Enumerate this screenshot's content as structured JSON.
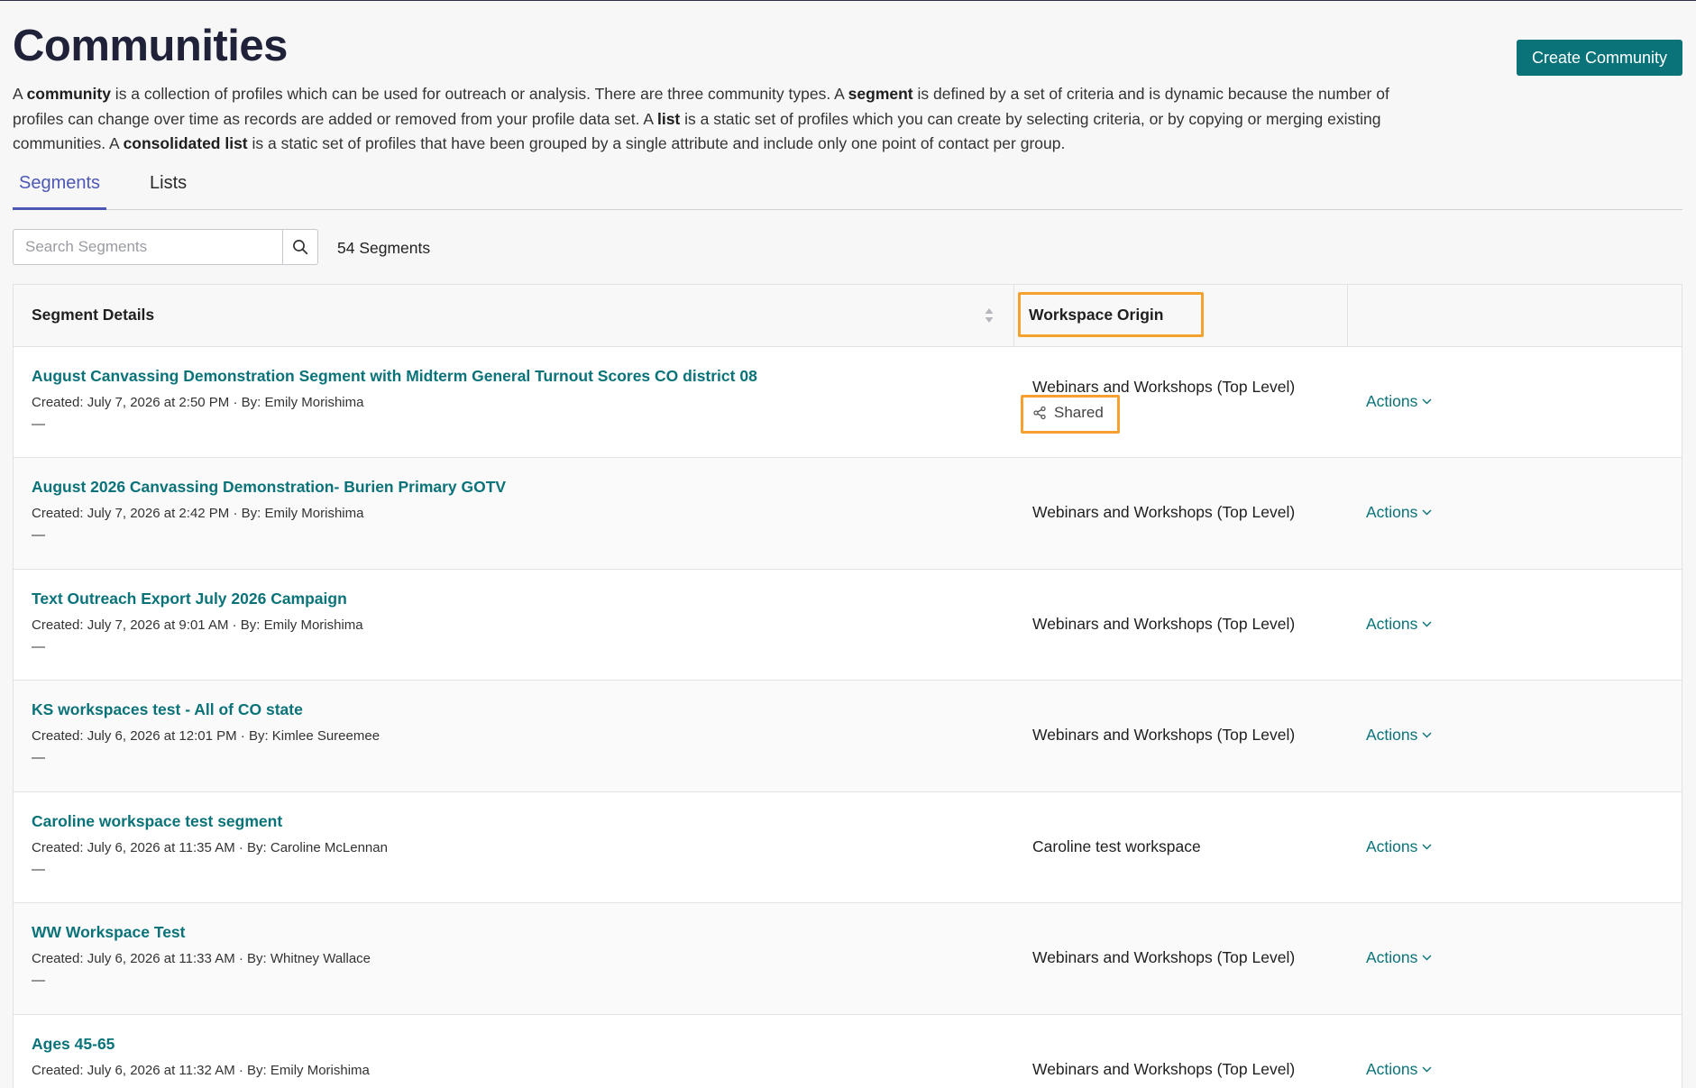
{
  "page": {
    "title": "Communities",
    "create_button": "Create Community",
    "description": {
      "p1": "A ",
      "b1": "community",
      "p2": " is a collection of profiles which can be used for outreach or analysis. There are three community types. A ",
      "b2": "segment",
      "p3": " is defined by a set of criteria and is dynamic because the number of profiles can change over time as records are added or removed from your profile data set. A ",
      "b3": "list",
      "p4": " is a static set of profiles which you can create by selecting criteria, or by copying or merging existing communities. A ",
      "b4": "consolidated list",
      "p5": " is a static set of profiles that have been grouped by a single attribute and include only one point of contact per group."
    }
  },
  "tabs": [
    {
      "label": "Segments",
      "active": true
    },
    {
      "label": "Lists",
      "active": false
    }
  ],
  "search": {
    "placeholder": "Search Segments",
    "value": "",
    "icon": "search-icon"
  },
  "segment_count": "54 Segments",
  "table": {
    "headers": {
      "details": "Segment Details",
      "origin": "Workspace Origin",
      "actions": ""
    },
    "rows": [
      {
        "name": "August Canvassing Demonstration Segment with Midterm General Turnout Scores CO district 08",
        "meta": "Created: July 7, 2026 at 2:50 PM · By: Emily Morishima",
        "dash": "—",
        "origin": "Webinars and Workshops (Top Level)",
        "shared": "Shared",
        "action": "Actions"
      },
      {
        "name": "August 2026 Canvassing Demonstration- Burien Primary GOTV",
        "meta": "Created: July 7, 2026 at 2:42 PM · By: Emily Morishima",
        "dash": "—",
        "origin": "Webinars and Workshops (Top Level)",
        "action": "Actions"
      },
      {
        "name": "Text Outreach Export July 2026 Campaign",
        "meta": "Created: July 7, 2026 at 9:01 AM · By: Emily Morishima",
        "dash": "—",
        "origin": "Webinars and Workshops (Top Level)",
        "action": "Actions"
      },
      {
        "name": "KS workspaces test - All of CO state",
        "meta": "Created: July 6, 2026 at 12:01 PM · By: Kimlee Sureemee",
        "dash": "—",
        "origin": "Webinars and Workshops (Top Level)",
        "action": "Actions"
      },
      {
        "name": "Caroline workspace test segment",
        "meta": "Created: July 6, 2026 at 11:35 AM · By: Caroline McLennan",
        "dash": "—",
        "origin": "Caroline test workspace",
        "action": "Actions"
      },
      {
        "name": "WW Workspace Test",
        "meta": "Created: July 6, 2026 at 11:33 AM · By: Whitney Wallace",
        "dash": "—",
        "origin": "Webinars and Workshops (Top Level)",
        "action": "Actions"
      },
      {
        "name": "Ages 45-65",
        "meta": "Created: July 6, 2026 at 11:32 AM · By: Emily Morishima",
        "dash": "—",
        "origin": "Webinars and Workshops (Top Level)",
        "action": "Actions"
      }
    ]
  },
  "colors": {
    "accent": "#0a7379",
    "tab_active": "#4d58b5",
    "highlight": "#f5a130",
    "title": "#20223a"
  }
}
